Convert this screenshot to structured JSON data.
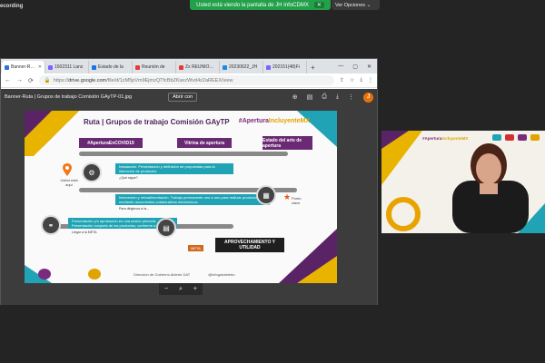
{
  "recording": {
    "label": "ecording"
  },
  "share_bar": {
    "label": "Usted está viendo la pantalla de JH InfoCDMX",
    "close": "✕"
  },
  "view_options": {
    "label": "Ver Opciones",
    "chevron": "⌄"
  },
  "browser": {
    "tabs": [
      {
        "label": "Banner-Ruta",
        "color": "#2f6fdd",
        "active": true
      },
      {
        "label": "1502311 Lanz",
        "color": "#7b61ff",
        "active": false
      },
      {
        "label": "Estado de la",
        "color": "#1a73e8",
        "active": false
      },
      {
        "label": "Reunión de",
        "color": "#e53935",
        "active": false
      },
      {
        "label": "Zx REUNIÓN - SUBIDADE",
        "color": "#e53935",
        "active": false
      },
      {
        "label": "20230622_JH",
        "color": "#1e88e5",
        "active": false
      },
      {
        "label": "202151(48)Fi",
        "color": "#7b61ff",
        "active": false
      }
    ],
    "new_tab": "+",
    "window_controls": {
      "minimize": "—",
      "maximize": "▢",
      "close": "✕"
    },
    "url": {
      "prefix": "https://",
      "domain": "drive.google.com",
      "path": "/file/d/1zM5pVm9EjmzQTfcBbZKsezWvd4z2aREEX/view"
    }
  },
  "viewer": {
    "filename": "Banner-Ruta | Grupos de trabajo Comisión GAyTP-01.jpg",
    "open_with": "Abrir con",
    "avatar": "J",
    "zoom": {
      "minus": "−",
      "zoom_icon": "⌕",
      "plus": "+"
    }
  },
  "slide": {
    "title": "Ruta | Grupos de trabajo Comisión GAyTP",
    "tag_prefix": "#Apertura",
    "tag_highlight": "IncluyenteMX",
    "bands": [
      "#AperturaEnCOVID19",
      "Vitrina de apertura",
      "Estado del arte de apertura"
    ],
    "usted": "Usted está aquí",
    "punto": "Punto clave",
    "steps": [
      {
        "title": "Instalación. Presentación y definición de propuestas para la liberación de productos",
        "q": "¿Qué sigue?"
      },
      {
        "title": "Intercesión y retroalimentación. Trabajo permanente uno a uno para realizar productos mediante documentos colaborativos electrónicos.",
        "q": "Para dirigirnos a la..."
      },
      {
        "title": "Presentación y/o aprobación en una sesión plenaria. Presentación conjunta de los productos, conforme a avances.",
        "q": "Llegar a la META"
      }
    ],
    "final": "APROVECHAMIENTO Y UTILIDAD",
    "meta": "META",
    "footer": [
      "Dirección de Gobierno Abierto DAT",
      "@infogobabierto"
    ]
  },
  "cam": {
    "tag_prefix": "#Apertura",
    "tag_highlight": "IncluyenteMX"
  }
}
